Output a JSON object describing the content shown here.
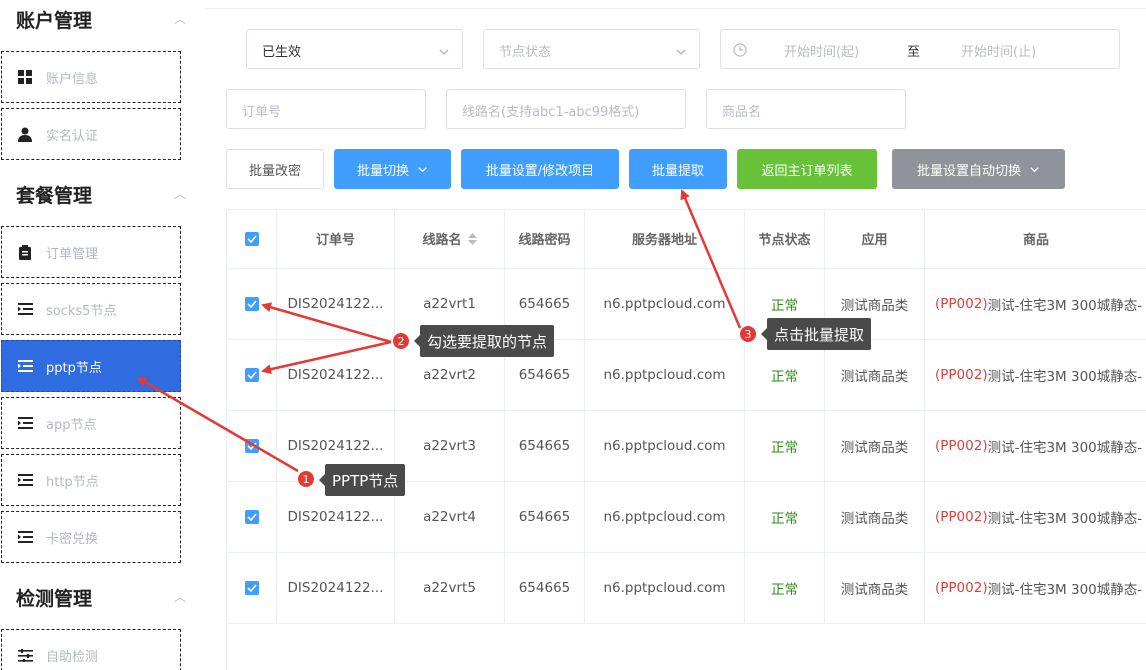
{
  "sidebar": {
    "groups": [
      {
        "title": "账户管理",
        "items": [
          {
            "label": "账户信息",
            "icon": "grid-icon"
          },
          {
            "label": "实名认证",
            "icon": "user-icon"
          }
        ]
      },
      {
        "title": "套餐管理",
        "items": [
          {
            "label": "订单管理",
            "icon": "clipboard-icon"
          },
          {
            "label": "socks5节点",
            "icon": "list-icon"
          },
          {
            "label": "pptp节点",
            "icon": "list-icon",
            "active": true
          },
          {
            "label": "app节点",
            "icon": "list-icon"
          },
          {
            "label": "http节点",
            "icon": "list-icon"
          },
          {
            "label": "卡密兑换",
            "icon": "list-icon"
          }
        ]
      },
      {
        "title": "检测管理",
        "items": [
          {
            "label": "自助检测",
            "icon": "sliders-icon"
          }
        ]
      }
    ]
  },
  "filters": {
    "status_select": "已生效",
    "node_status_placeholder": "节点状态",
    "date_start_placeholder": "开始时间(起)",
    "date_separator": "至",
    "date_end_placeholder": "开始时间(止)",
    "order_no_placeholder": "订单号",
    "line_name_placeholder": "线路名(支持abc1-abc99格式)",
    "product_placeholder": "商品名"
  },
  "toolbar": {
    "batch_password": "批量改密",
    "batch_switch": "批量切换",
    "batch_project": "批量设置/修改项目",
    "batch_extract": "批量提取",
    "back_to_orders": "返回主订单列表",
    "batch_auto_switch": "批量设置自动切换"
  },
  "table": {
    "headers": [
      "订单号",
      "线路名",
      "线路密码",
      "服务器地址",
      "节点状态",
      "应用",
      "商品"
    ],
    "rows": [
      {
        "order": "DIS2024122...",
        "line": "a22vrt1",
        "pwd": "654665",
        "server": "n6.pptpcloud.com",
        "status": "正常",
        "app": "测试商品类",
        "product_code": "(PP002)",
        "product_name": " 测试-住宅3M 300城静态-"
      },
      {
        "order": "DIS2024122...",
        "line": "a22vrt2",
        "pwd": "654665",
        "server": "n6.pptpcloud.com",
        "status": "正常",
        "app": "测试商品类",
        "product_code": "(PP002)",
        "product_name": " 测试-住宅3M 300城静态-"
      },
      {
        "order": "DIS2024122...",
        "line": "a22vrt3",
        "pwd": "654665",
        "server": "n6.pptpcloud.com",
        "status": "正常",
        "app": "测试商品类",
        "product_code": "(PP002)",
        "product_name": " 测试-住宅3M 300城静态-"
      },
      {
        "order": "DIS2024122...",
        "line": "a22vrt4",
        "pwd": "654665",
        "server": "n6.pptpcloud.com",
        "status": "正常",
        "app": "测试商品类",
        "product_code": "(PP002)",
        "product_name": " 测试-住宅3M 300城静态-"
      },
      {
        "order": "DIS2024122...",
        "line": "a22vrt5",
        "pwd": "654665",
        "server": "n6.pptpcloud.com",
        "status": "正常",
        "app": "测试商品类",
        "product_code": "(PP002)",
        "product_name": " 测试-住宅3M 300城静态-"
      }
    ]
  },
  "annotations": [
    {
      "num": "1",
      "text": "PPTP节点"
    },
    {
      "num": "2",
      "text": "勾选要提取的节点"
    },
    {
      "num": "3",
      "text": "点击批量提取"
    }
  ],
  "colors": {
    "primary": "#409eff",
    "sidebar_active": "#2f6ce0",
    "green": "#67c23a",
    "gray": "#909399",
    "status_ok": "#2e8b17",
    "code_red": "#e0403a",
    "annotation_red": "#e53935"
  }
}
